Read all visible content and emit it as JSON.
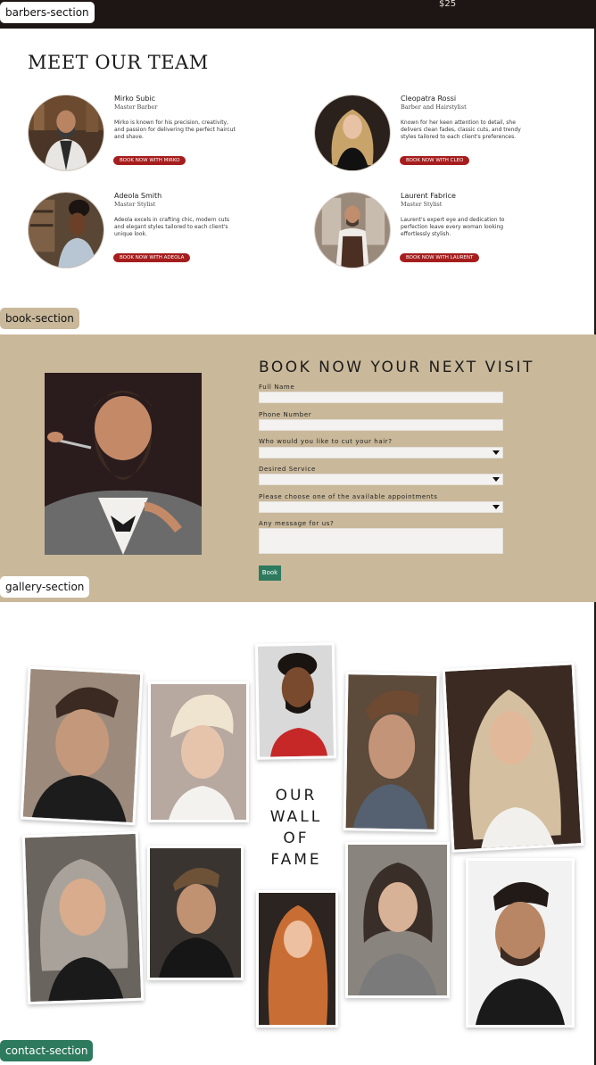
{
  "topbar": {
    "price": "$25"
  },
  "section_tags": {
    "barbers": "barbers-section",
    "book": "book-section",
    "gallery": "gallery-section",
    "contact": "contact-section"
  },
  "team": {
    "title": "MEET OUR TEAM",
    "barbers": [
      {
        "name": "Mirko Subic",
        "role": "Master Barber",
        "bio": "Mirko is known for his precision, creativity, and passion for delivering the perfect haircut and shave.",
        "button": "BOOK NOW WITH MIRKO"
      },
      {
        "name": "Cleopatra Rossi",
        "role": "Barber and Hairstylist",
        "bio": "Known for her keen attention to detail, she delivers clean fades, classic cuts, and trendy styles tailored to each client's preferences.",
        "button": "BOOK NOW WITH CLEO"
      },
      {
        "name": "Adeola Smith",
        "role": "Master Stylist",
        "bio": "Adeola excels in crafting chic, modern cuts and elegant styles tailored to each client's unique look.",
        "button": "BOOK NOW WITH ADEOLA"
      },
      {
        "name": "Laurent Fabrice",
        "role": "Master Stylist",
        "bio": "Laurent's expert eye and dedication to perfection leave every woman looking effortlessly stylish.",
        "button": "BOOK NOW WITH LAURENT"
      }
    ]
  },
  "booking": {
    "title": "BOOK NOW YOUR NEXT VISIT",
    "fields": {
      "full_name": "Full Name",
      "phone": "Phone Number",
      "barber": "Who would you like to cut your hair?",
      "service": "Desired Service",
      "appointment": "Please choose one of the available appointments",
      "message": "Any message for us?"
    },
    "submit": "Book"
  },
  "gallery": {
    "title_lines": [
      "OUR",
      "WALL",
      "OF",
      "FAME"
    ]
  },
  "icons": {
    "select_arrow": "chevron-down-icon"
  },
  "colors": {
    "accent_red": "#a61d1d",
    "accent_green": "#2d7a5e",
    "sand": "#c9b89a",
    "dark": "#1e1614"
  }
}
